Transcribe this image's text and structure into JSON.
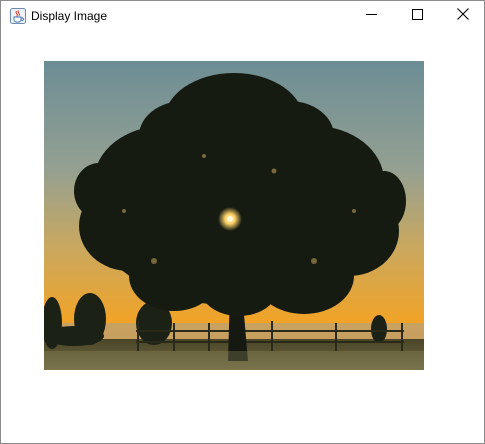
{
  "window": {
    "title": "Display Image",
    "icon": "java-cup-icon",
    "controls": {
      "minimize_icon": "minimize-icon",
      "maximize_icon": "maximize-icon",
      "close_icon": "close-icon"
    }
  },
  "content": {
    "image": {
      "subject": "tree-silhouette-sunset",
      "colors": {
        "sky_top": "#6f8f96",
        "sky_mid": "#b6a77a",
        "sky_low": "#f0a52a",
        "ground": "#3a3a1e",
        "silhouette": "#141810"
      }
    }
  }
}
